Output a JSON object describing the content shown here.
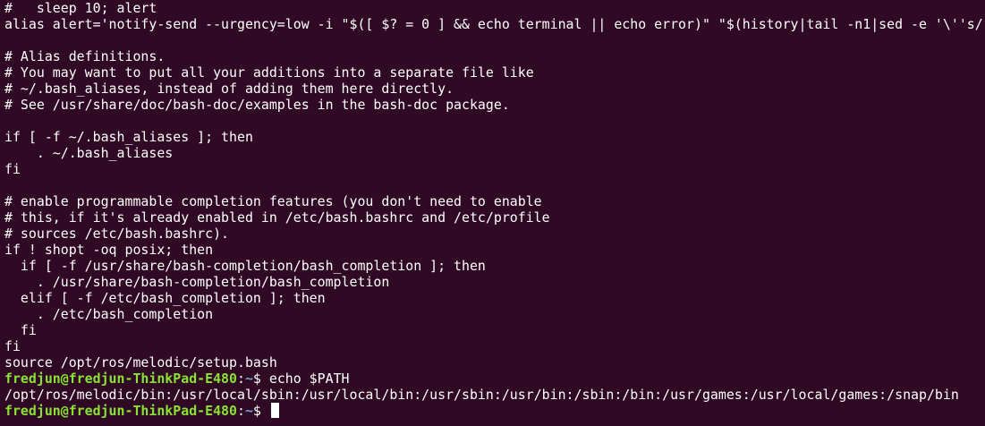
{
  "terminal": {
    "colors": {
      "background": "#300a24",
      "foreground": "#ffffff",
      "prompt_user": "#8ae234",
      "prompt_path": "#729fcf"
    },
    "output_lines": [
      "#   sleep 10; alert",
      "alias alert='notify-send --urgency=low -i \"$([ $? = 0 ] && echo terminal || echo error)\" \"$(history|tail -n1|sed -e '\\''s/",
      "",
      "# Alias definitions.",
      "# You may want to put all your additions into a separate file like",
      "# ~/.bash_aliases, instead of adding them here directly.",
      "# See /usr/share/doc/bash-doc/examples in the bash-doc package.",
      "",
      "if [ -f ~/.bash_aliases ]; then",
      "    . ~/.bash_aliases",
      "fi",
      "",
      "# enable programmable completion features (you don't need to enable",
      "# this, if it's already enabled in /etc/bash.bashrc and /etc/profile",
      "# sources /etc/bash.bashrc).",
      "if ! shopt -oq posix; then",
      "  if [ -f /usr/share/bash-completion/bash_completion ]; then",
      "    . /usr/share/bash-completion/bash_completion",
      "  elif [ -f /etc/bash_completion ]; then",
      "    . /etc/bash_completion",
      "  fi",
      "fi",
      "source /opt/ros/melodic/setup.bash"
    ],
    "prompt": {
      "user_host": "fredjun@fredjun-ThinkPad-E480",
      "separator": ":",
      "path": "~",
      "symbol": "$ "
    },
    "command_1": "echo $PATH",
    "path_output": "/opt/ros/melodic/bin:/usr/local/sbin:/usr/local/bin:/usr/sbin:/usr/bin:/sbin:/bin:/usr/games:/usr/local/games:/snap/bin",
    "command_2": ""
  }
}
